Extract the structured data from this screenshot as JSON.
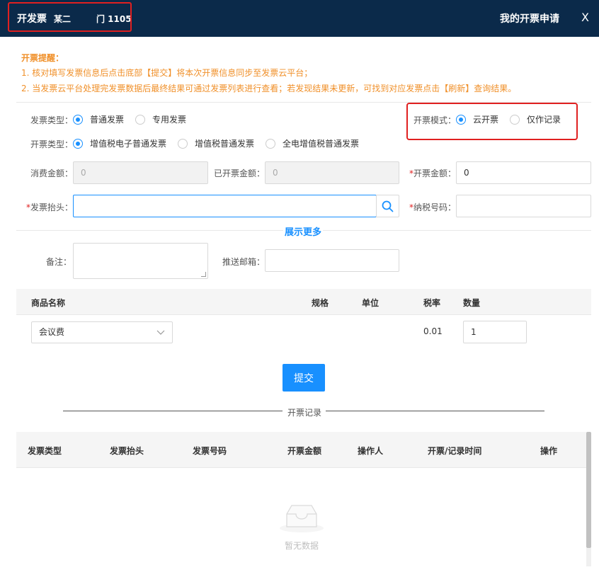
{
  "header": {
    "title": "开发票",
    "subtitle": "某二　　　门 1105",
    "apply_link": "我的开票申请",
    "close": "X"
  },
  "notice": {
    "title": "开票提醒：",
    "line1": "1. 核对填写发票信息后点击底部【提交】将本次开票信息同步至发票云平台；",
    "line2": "2. 当发票云平台处理完发票数据后最终结果可通过发票列表进行查看；若发现结果未更新，可找到对应发票点击【刷新】查询结果。"
  },
  "form": {
    "invoice_type_label": "发票类型：",
    "invoice_type_options": [
      "普通发票",
      "专用发票"
    ],
    "invoice_type_selected": "普通发票",
    "mode_label": "开票模式：",
    "mode_options": [
      "云开票",
      "仅作记录"
    ],
    "mode_selected": "云开票",
    "billing_type_label": "开票类型：",
    "billing_type_options": [
      "增值税电子普通发票",
      "增值税普通发票",
      "全电增值税普通发票"
    ],
    "billing_type_selected": "增值税电子普通发票",
    "consume_label": "消费金额：",
    "consume_value": "0",
    "invoiced_label": "已开票金额：",
    "invoiced_value": "0",
    "amount_label": "开票金额：",
    "amount_value": "0",
    "header_label": "发票抬头：",
    "header_value": "",
    "tax_no_label": "纳税号码：",
    "tax_no_value": "",
    "show_more": "展示更多",
    "remark_label": "备注：",
    "email_label": "推送邮箱：",
    "required_mark": "*"
  },
  "goods": {
    "columns": [
      "商品名称",
      "规格",
      "单位",
      "税率",
      "数量"
    ],
    "row": {
      "name": "会议费",
      "tax": "0.01",
      "qty": "1"
    }
  },
  "submit_label": "提交",
  "records": {
    "title": "开票记录",
    "columns": [
      "发票类型",
      "发票抬头",
      "发票号码",
      "开票金额",
      "操作人",
      "开票/记录时间",
      "操作"
    ],
    "empty_text": "暂无数据"
  },
  "colors": {
    "header_bg": "#0b2a4a",
    "primary": "#1890ff",
    "notice": "#f0902a",
    "highlight": "#e02020"
  }
}
